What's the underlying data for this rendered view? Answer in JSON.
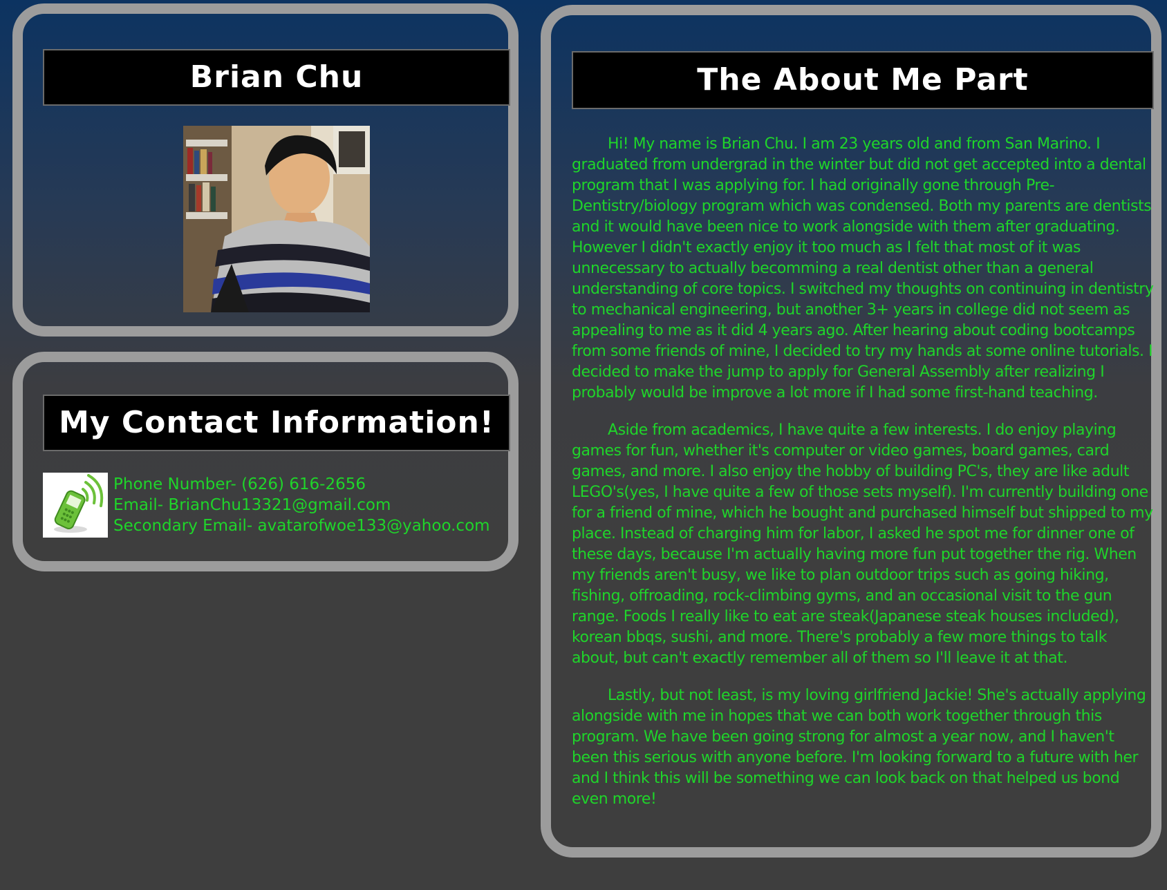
{
  "profile": {
    "name": "Brian Chu",
    "photo_icon": "profile-photo"
  },
  "contact": {
    "title": "My Contact Information!",
    "icon": "mobile-phone-icon",
    "phone": "Phone Number- (626) 616-2656",
    "email": "Email- BrianChu13321@gmail.com",
    "secondary_email": "Secondary Email- avatarofwoe133@yahoo.com"
  },
  "about": {
    "title": "The About Me Part",
    "paragraphs": [
      "Hi! My name is Brian Chu. I am 23 years old and from San Marino. I graduated from undergrad in the winter but did not get accepted into a dental program that I was applying for. I had originally gone through Pre-Dentistry/biology program which was condensed. Both my parents are dentists and it would have been nice to work alongside with them after graduating. However I didn't exactly enjoy it too much as I felt that most of it was unnecessary to actually becomming a real dentist other than a general understanding of core topics. I switched my thoughts on continuing in dentistry to mechanical engineering, but another 3+ years in college did not seem as appealing to me as it did 4 years ago. After hearing about coding bootcamps from some friends of mine, I decided to try my hands at some online tutorials. I decided to make the jump to apply for General Assembly after realizing I probably would be improve a lot more if I had some first-hand teaching.",
      "Aside from academics, I have quite a few interests. I do enjoy playing games for fun, whether it's computer or video games, board games, card games, and more. I also enjoy the hobby of building PC's, they are like adult LEGO's(yes, I have quite a few of those sets myself). I'm currently building one for a friend of mine, which he bought and purchased himself but shipped to my place. Instead of charging him for labor, I asked he spot me for dinner one of these days, because I'm actually having more fun put together the rig. When my friends aren't busy, we like to plan outdoor trips such as going hiking, fishing, offroading, rock-climbing gyms, and an occasional visit to the gun range. Foods I really like to eat are steak(Japanese steak houses included), korean bbqs, sushi, and more. There's probably a few more things to talk about, but can't exactly remember all of them so I'll leave it at that.",
      "Lastly, but not least, is my loving girlfriend Jackie! She's actually applying alongside with me in hopes that we can both work together through this program. We have been going strong for almost a year now, and I haven't been this serious with anyone before. I'm looking forward to a future with her and I think this will be something we can look back on that helped us bond even more!"
    ]
  },
  "colors": {
    "text_green": "#1fd52a",
    "panel_border": "#9c9c9c",
    "title_background": "#000000",
    "page_top": "#0c3361",
    "page_bottom": "#3e3e3e"
  }
}
